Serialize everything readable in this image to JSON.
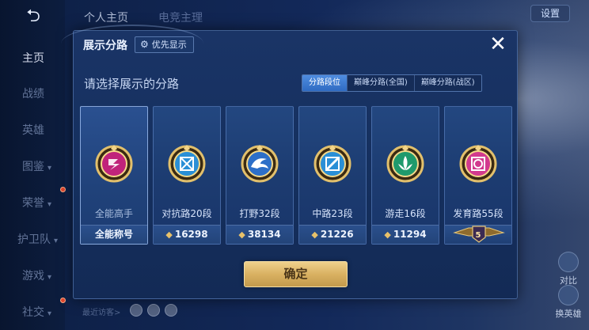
{
  "sidebar": {
    "items": [
      {
        "label": "主页",
        "active": true
      },
      {
        "label": "战绩"
      },
      {
        "label": "英雄"
      },
      {
        "label": "图鉴",
        "arrow": "▾"
      },
      {
        "label": "荣誉",
        "arrow": "▾"
      },
      {
        "label": "护卫队",
        "arrow": "▾"
      },
      {
        "label": "游戏",
        "arrow": "▾"
      },
      {
        "label": "社交",
        "arrow": "▾"
      }
    ]
  },
  "top_tabs": [
    {
      "label": "个人主页",
      "active": true
    },
    {
      "label": "电竞主理"
    }
  ],
  "settings_label": "设置",
  "recent_visitors_label": "最近访客>",
  "right_actions": [
    {
      "label": "对比"
    },
    {
      "label": "换英雄"
    }
  ],
  "modal": {
    "title": "展示分路",
    "priority_label": "优先显示",
    "close_symbol": "✕",
    "prompt": "请选择展示的分路",
    "segments": [
      {
        "label": "分路段位",
        "active": true
      },
      {
        "label": "巅峰分路(全国)"
      },
      {
        "label": "巅峰分路(战区)"
      }
    ],
    "cards": [
      {
        "name": "全能高手",
        "footer": "全能称号",
        "badge_icon": "all-round-badge-icon",
        "badge_color": "#c0237b",
        "selected": true
      },
      {
        "name": "对抗路20段",
        "footer_value": "16298",
        "badge_icon": "clash-lane-badge-icon",
        "badge_color": "#2a8fd6"
      },
      {
        "name": "打野32段",
        "footer_value": "38134",
        "badge_icon": "jungle-badge-icon",
        "badge_color": "#2d6fc8"
      },
      {
        "name": "中路23段",
        "footer_value": "21226",
        "badge_icon": "mid-lane-badge-icon",
        "badge_color": "#2a8fd6"
      },
      {
        "name": "游走16段",
        "footer_value": "11294",
        "badge_icon": "roam-badge-icon",
        "badge_color": "#1f9a6c"
      },
      {
        "name": "发育路55段",
        "footer_rank": "5",
        "badge_icon": "farm-lane-badge-icon",
        "badge_color": "#d23a8e"
      }
    ],
    "confirm_label": "确定"
  },
  "colors": {
    "accent_gold": "#d9b162",
    "active_tab": "#4f8de0",
    "panel": "#1a3466"
  }
}
